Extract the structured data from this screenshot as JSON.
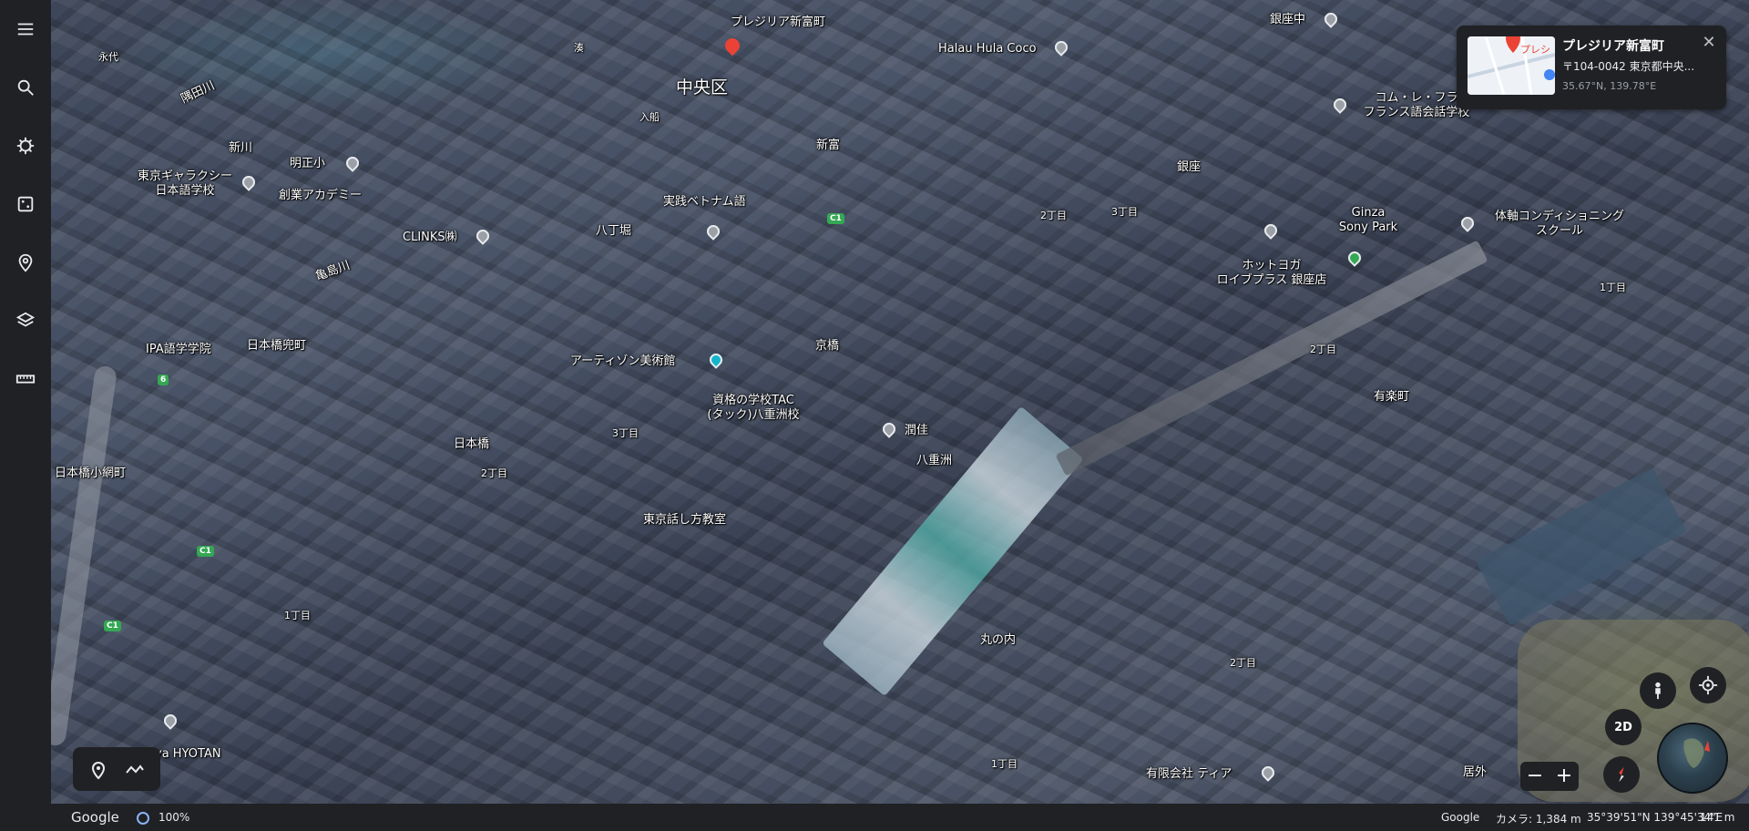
{
  "sidebar": {
    "items": [
      {
        "name": "menu-icon"
      },
      {
        "name": "search-icon"
      },
      {
        "name": "voyager-icon"
      },
      {
        "name": "random-icon"
      },
      {
        "name": "projects-icon"
      },
      {
        "name": "map-style-icon"
      },
      {
        "name": "measure-icon"
      }
    ]
  },
  "map": {
    "labels": {
      "eitai": "永代",
      "sumidagawa": "隅田川",
      "minato": "湊",
      "shinkawa": "新川",
      "meishosho": "明正小",
      "tokyo_galaxy": "東京ギャラクシー\n日本語学校",
      "soshin": "創業アカデミー",
      "clinks": "CLINKS㈱",
      "hatchobori": "八丁堀",
      "kamejimagawa": "亀島川",
      "ipa": "IPA語学学院",
      "nihonbashi_kabutocho": "日本橋兜町",
      "nihonbashi": "日本橋",
      "nihonbashi_koamicho": "日本橋小網町",
      "chuo_ku": "中央区",
      "irifune": "入船",
      "jissen_vietnam": "実践ベトナム語",
      "artizon": "アーティゾン美術館",
      "tac": "資格の学校TAC\n(タック)八重洲校",
      "kyobashi": "京橋",
      "junka": "潤佳",
      "yaesu": "八重洲",
      "tokyo_hanashikata": "東京話し方教室",
      "sanchome": "3丁目",
      "nichome_a": "2丁目",
      "itchome_a": "1丁目",
      "marunouchi": "丸の内",
      "itchome_b": "1丁目",
      "nichome_b": "2丁目",
      "shintomi": "新富",
      "nichome_c": "2丁目",
      "sanchome_b": "3丁目",
      "ginza": "銀座",
      "ginza1": "銀座中",
      "halau": "Halau Hula Coco",
      "comme": "コム・レ・フラ\nフランス語会話学校",
      "ginza_sony": "Ginza\nSony Park",
      "hot_yoga": "ホットヨガ\nロイブプラス 銀座店",
      "taijiku": "体軸コンディショニング\nスクール",
      "itchome_c": "1丁目",
      "nichome_d": "2丁目",
      "yurakucho": "有楽町",
      "tiara": "有限会社 ティア",
      "hyotan": "ya HYOTAN",
      "selected_pin": "プレジリア新富町",
      "route_c1": "C1",
      "route_6": "6",
      "kyogai": "居外"
    }
  },
  "info_card": {
    "title": "プレジリア新富町",
    "thumb_label": "プレシ",
    "address": "〒104-0042 東京都中央...",
    "coords": "35.67°N, 139.78°E"
  },
  "controls": {
    "view_2d": "2D",
    "zoom_out": "−",
    "zoom_in": "+"
  },
  "bottom_bar": {
    "logo": "Google",
    "load_percent": "100%",
    "attribution": "Google",
    "camera": "カメラ: 1,384 m",
    "position": "35°39'51\"N 139°45'34\"E",
    "altitude": "141 m"
  },
  "colors": {
    "sidebar_bg": "#202124",
    "accent_red": "#ea4335",
    "accent_green": "#34a853",
    "loading_blue": "#8ab4f8"
  }
}
